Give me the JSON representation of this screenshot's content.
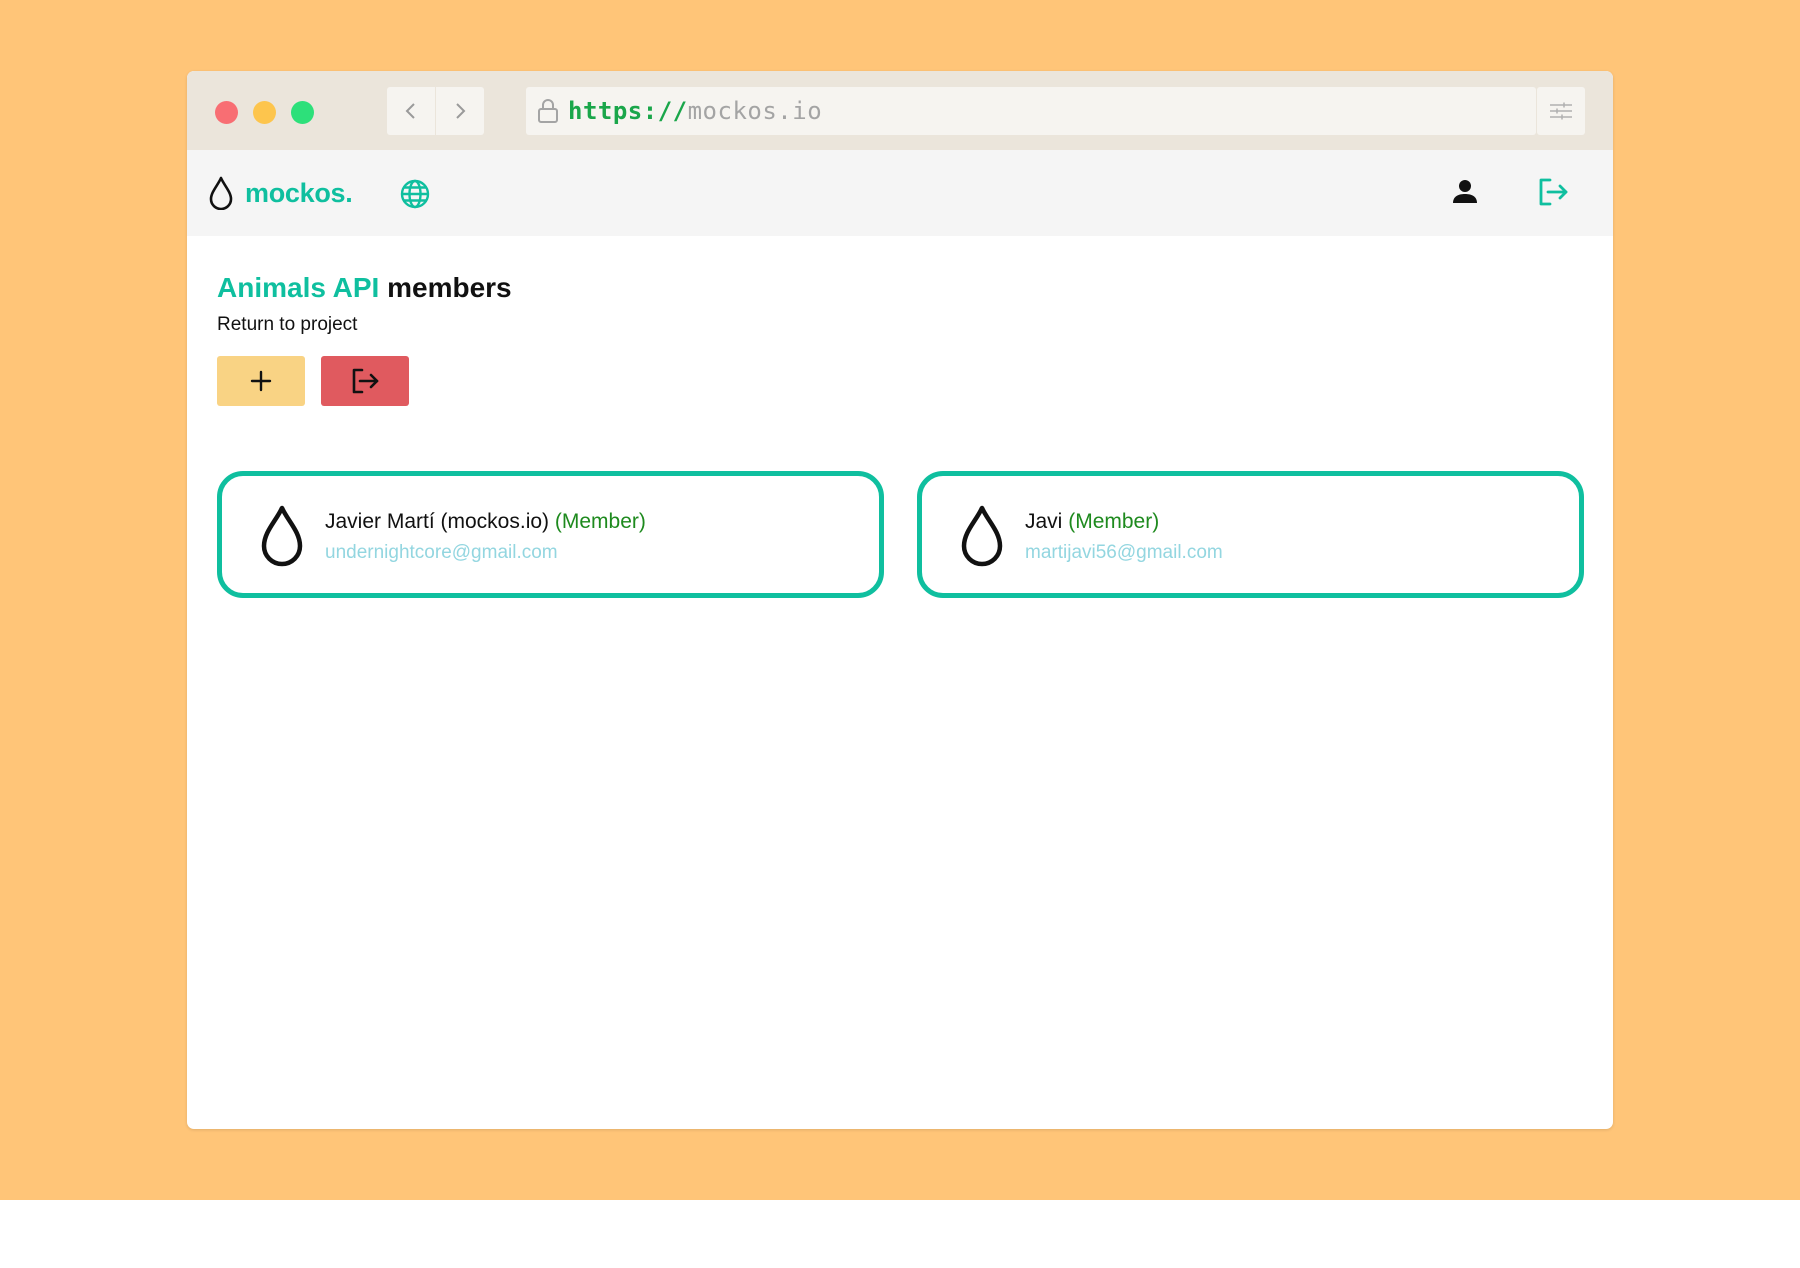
{
  "browser": {
    "url_scheme": "https://",
    "url_host": "mockos.io",
    "traffic_lights": {
      "close": "#f86e73",
      "minimize": "#fdc54d",
      "maximize": "#2de07a"
    }
  },
  "navbar": {
    "brand": "mockos.",
    "brand_color": "#0fbf9f",
    "icons": [
      "drop-logo-icon",
      "globe-icon",
      "user-icon",
      "logout-icon"
    ]
  },
  "page": {
    "project_name": "Animals API",
    "title_suffix": " members",
    "return_link": "Return to project",
    "add_button_icon": "plus-icon",
    "leave_button_icon": "logout-icon"
  },
  "members": [
    {
      "name": "Javier Martí (mockos.io)",
      "role": "(Member)",
      "email": "undernightcore@gmail.com"
    },
    {
      "name": "Javi",
      "role": "(Member)",
      "email": "martijavi56@gmail.com"
    }
  ],
  "colors": {
    "accent": "#0fbf9f",
    "add_button": "#f9d384",
    "leave_button": "#e05a5f",
    "role_text": "#1e8a1e",
    "email_text": "#93d6e0",
    "backdrop": "#ffc578"
  }
}
